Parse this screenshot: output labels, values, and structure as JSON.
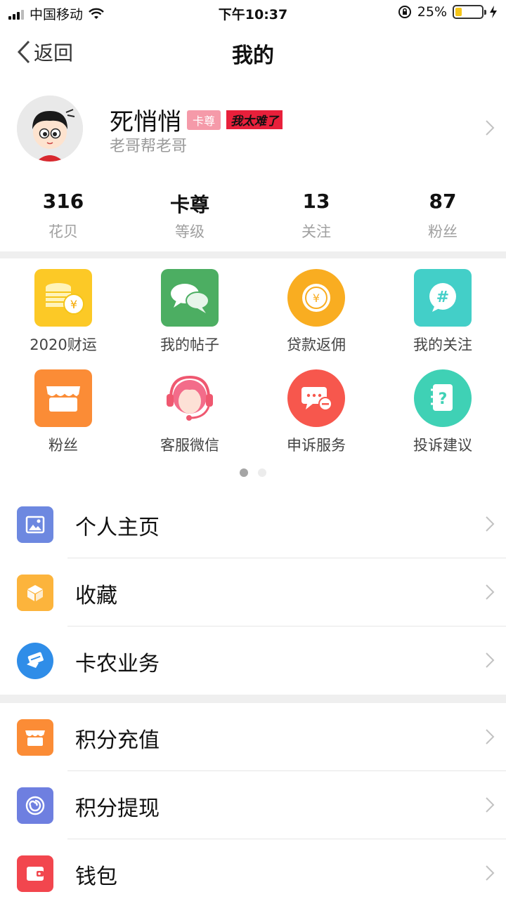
{
  "status_bar": {
    "carrier": "中国移动",
    "time": "下午10:37",
    "battery": "25%",
    "battery_fraction": 0.25,
    "icons": [
      "signal-icon",
      "wifi-icon",
      "rotation-lock-icon",
      "battery-icon",
      "charging-icon"
    ]
  },
  "nav": {
    "back_label": "返回",
    "title": "我的"
  },
  "profile": {
    "name": "死悄悄",
    "badge_level": "卡尊",
    "badge_tag": "我太难了",
    "subtitle": "老哥帮老哥"
  },
  "stats": [
    {
      "value": "316",
      "label": "花贝"
    },
    {
      "value": "卡尊",
      "label": "等级"
    },
    {
      "value": "13",
      "label": "关注"
    },
    {
      "value": "87",
      "label": "粉丝"
    }
  ],
  "grid": [
    {
      "label": "2020财运",
      "icon": "coins-icon",
      "color": "#fcc926"
    },
    {
      "label": "我的帖子",
      "icon": "chat-bubbles-icon",
      "color": "#4cae62"
    },
    {
      "label": "贷款返佣",
      "icon": "yuan-coin-icon",
      "color": "#f9ad21"
    },
    {
      "label": "我的关注",
      "icon": "hashtag-icon",
      "color": "#43cfc8"
    },
    {
      "label": "粉丝",
      "icon": "shop-icon",
      "color": "#fb8c36"
    },
    {
      "label": "客服微信",
      "icon": "headset-agent-icon",
      "color": "#ef5870"
    },
    {
      "label": "申诉服务",
      "icon": "message-minus-icon",
      "color": "#f7574d"
    },
    {
      "label": "投诉建议",
      "icon": "question-notebook-icon",
      "color": "#3fd1b5"
    }
  ],
  "pager": {
    "pages": 2,
    "active": 1
  },
  "menu_group1": [
    {
      "label": "个人主页",
      "icon": "image-icon",
      "color": "#6d88e0"
    },
    {
      "label": "收藏",
      "icon": "box-icon",
      "color": "#fcb43c"
    },
    {
      "label": "卡农业务",
      "icon": "card-handshake-icon",
      "color": "#2f8de8"
    }
  ],
  "menu_group2": [
    {
      "label": "积分充值",
      "icon": "shop-icon",
      "color": "#fb8c36"
    },
    {
      "label": "积分提现",
      "icon": "swirl-icon",
      "color": "#6e7fe0"
    },
    {
      "label": "钱包",
      "icon": "wallet-icon",
      "color": "#f2464e"
    }
  ]
}
